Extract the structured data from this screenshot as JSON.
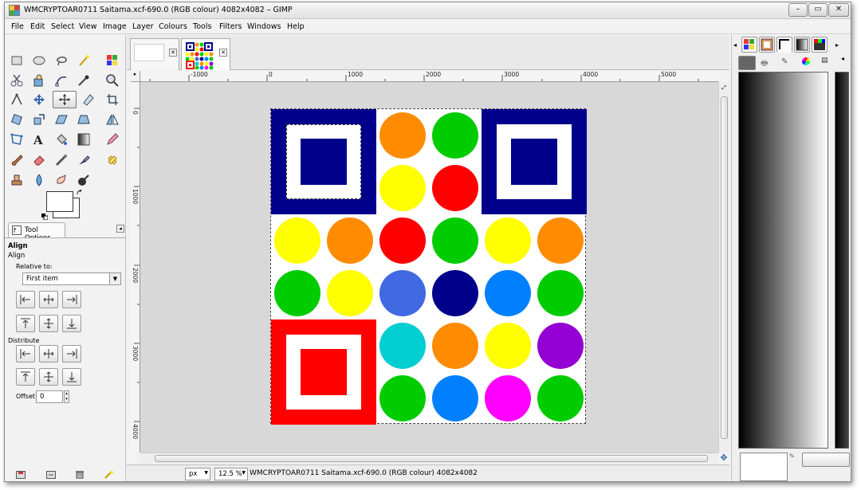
{
  "window": {
    "title": "WMCRYPTOAR0711 Saitama.xcf-690.0 (RGB colour) 4082x4082 – GIMP",
    "minimize_glyph": "–",
    "maximize_glyph": "▭",
    "close_glyph": "✕"
  },
  "menubar": [
    "File",
    "Edit",
    "Select",
    "View",
    "Image",
    "Layer",
    "Colours",
    "Tools",
    "Filters",
    "Windows",
    "Help"
  ],
  "tool_options": {
    "tab_label": "Tool Options",
    "tool_title": "Align",
    "section_align": "Align",
    "relative_to_label": "Relative to:",
    "relative_to_value": "First item",
    "distribute_label": "Distribute",
    "offset_label": "Offset:",
    "offset_value": "0"
  },
  "ruler": {
    "h_labels": [
      "-1000",
      "0",
      "1000",
      "2000",
      "3000",
      "4000",
      "5000"
    ],
    "v_labels": [
      "0",
      "1000",
      "2000",
      "3000",
      "4000"
    ]
  },
  "status": {
    "unit": "px",
    "zoom": "12.5 %",
    "message": "WMCRYPTOAR0711 Saitama.xcf-690.0 (RGB colour) 4082x4082"
  },
  "image_colors": {
    "navy": "#00008b",
    "red": "#ff0000",
    "orange": "#ff8c00",
    "green": "#00cc00",
    "yellow": "#ffff00",
    "royal_blue": "#4169e1",
    "azure": "#0080ff",
    "cyan": "#00ced1",
    "purple": "#9400d3",
    "magenta": "#ff00ff"
  }
}
